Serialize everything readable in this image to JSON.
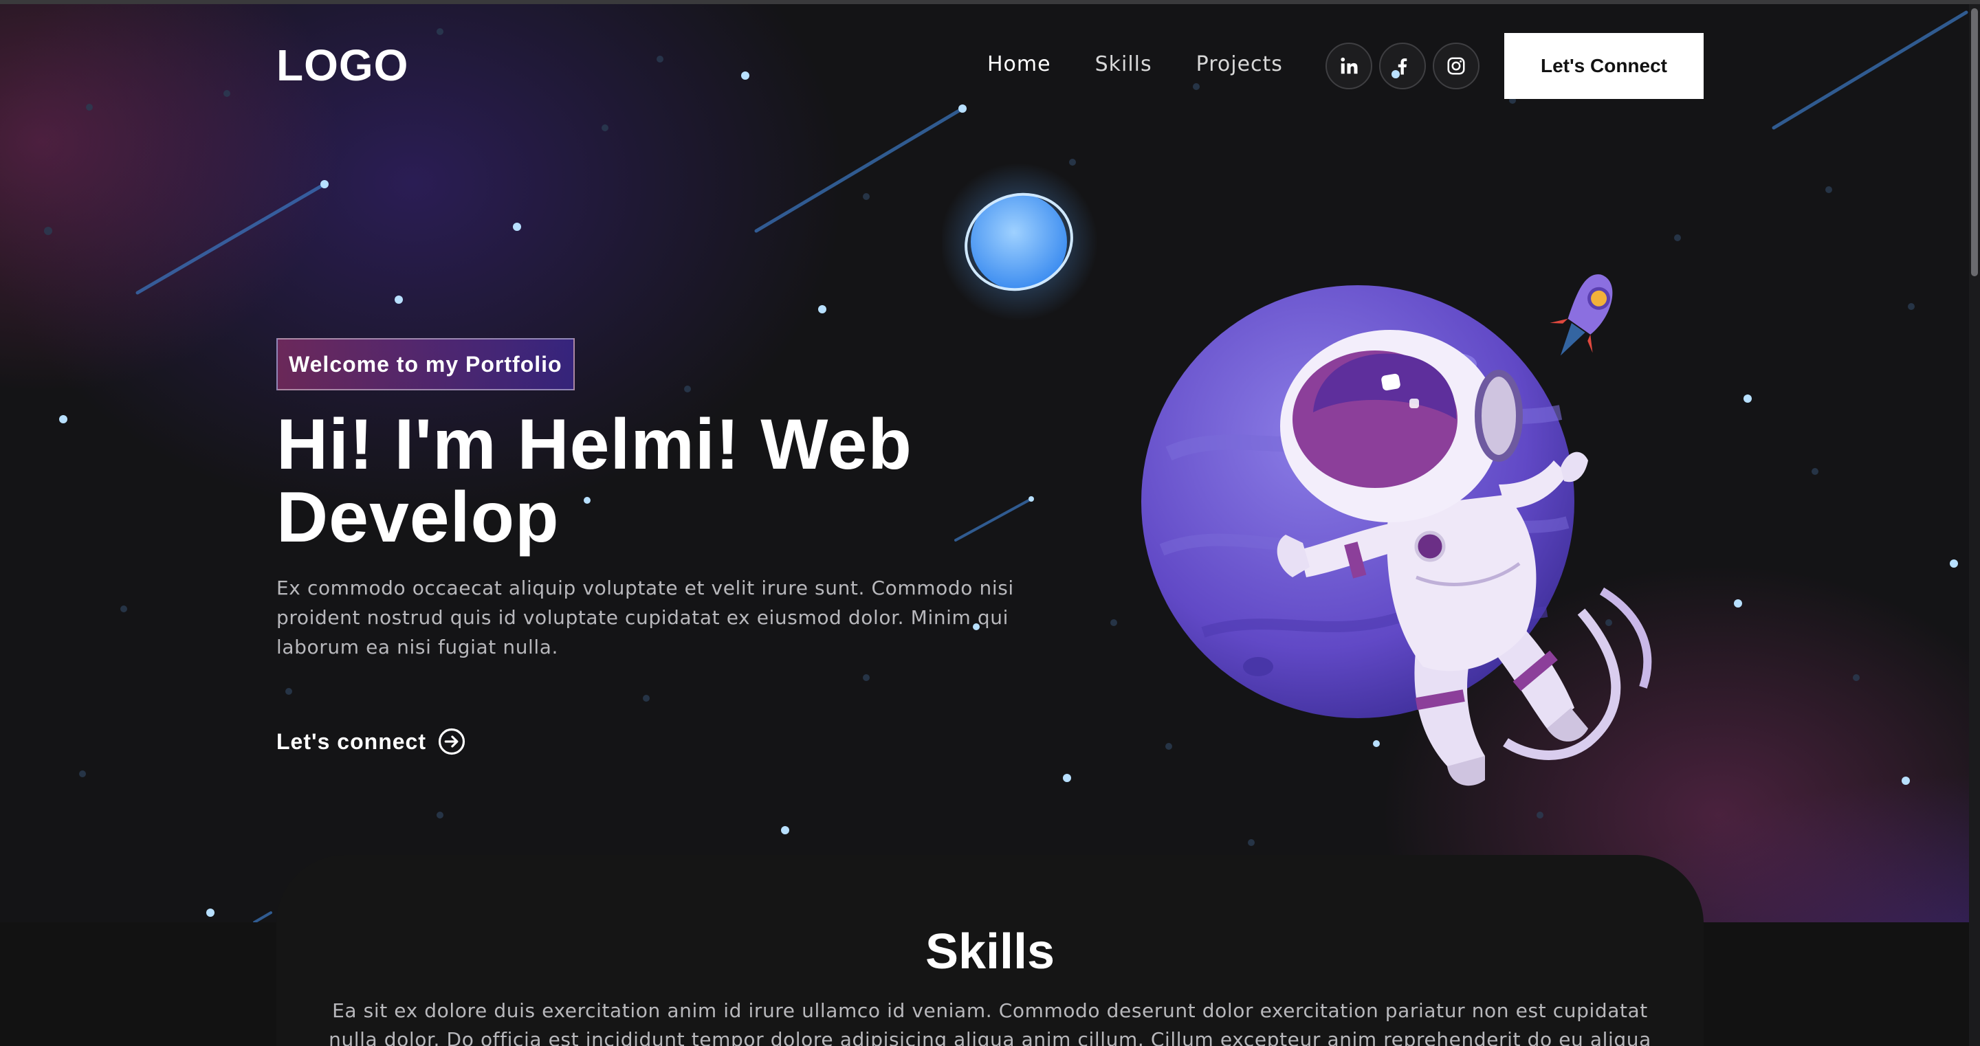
{
  "nav": {
    "logo": "LOGO",
    "links": [
      "Home",
      "Skills",
      "Projects"
    ],
    "connect_label": "Let's Connect",
    "socials": [
      "linkedin-icon",
      "facebook-icon",
      "instagram-icon"
    ]
  },
  "hero": {
    "tagline": "Welcome to my Portfolio",
    "headline_line1": "Hi! I'm Helmi! Web",
    "headline_line2": "Develop",
    "paragraph": "Ex commodo occaecat aliquip voluptate et velit irure sunt. Commodo nisi proident nostrud quis id voluptate cupidatat ex eiusmod dolor. Minim qui laborum ea nisi fugiat nulla.",
    "cta_label": "Let's connect"
  },
  "skills": {
    "title": "Skills",
    "text": "Ea sit ex dolore duis exercitation anim id irure ullamco id veniam. Commodo deserunt dolor exercitation pariatur non est cupidatat nulla dolor. Do officia est incididunt tempor dolore adipisicing aliqua anim cillum. Cillum excepteur anim reprehenderit do eu aliqua"
  },
  "colors": {
    "accent_pink": "#aa367c",
    "accent_purple": "#4a2fbd",
    "background": "#121212"
  }
}
